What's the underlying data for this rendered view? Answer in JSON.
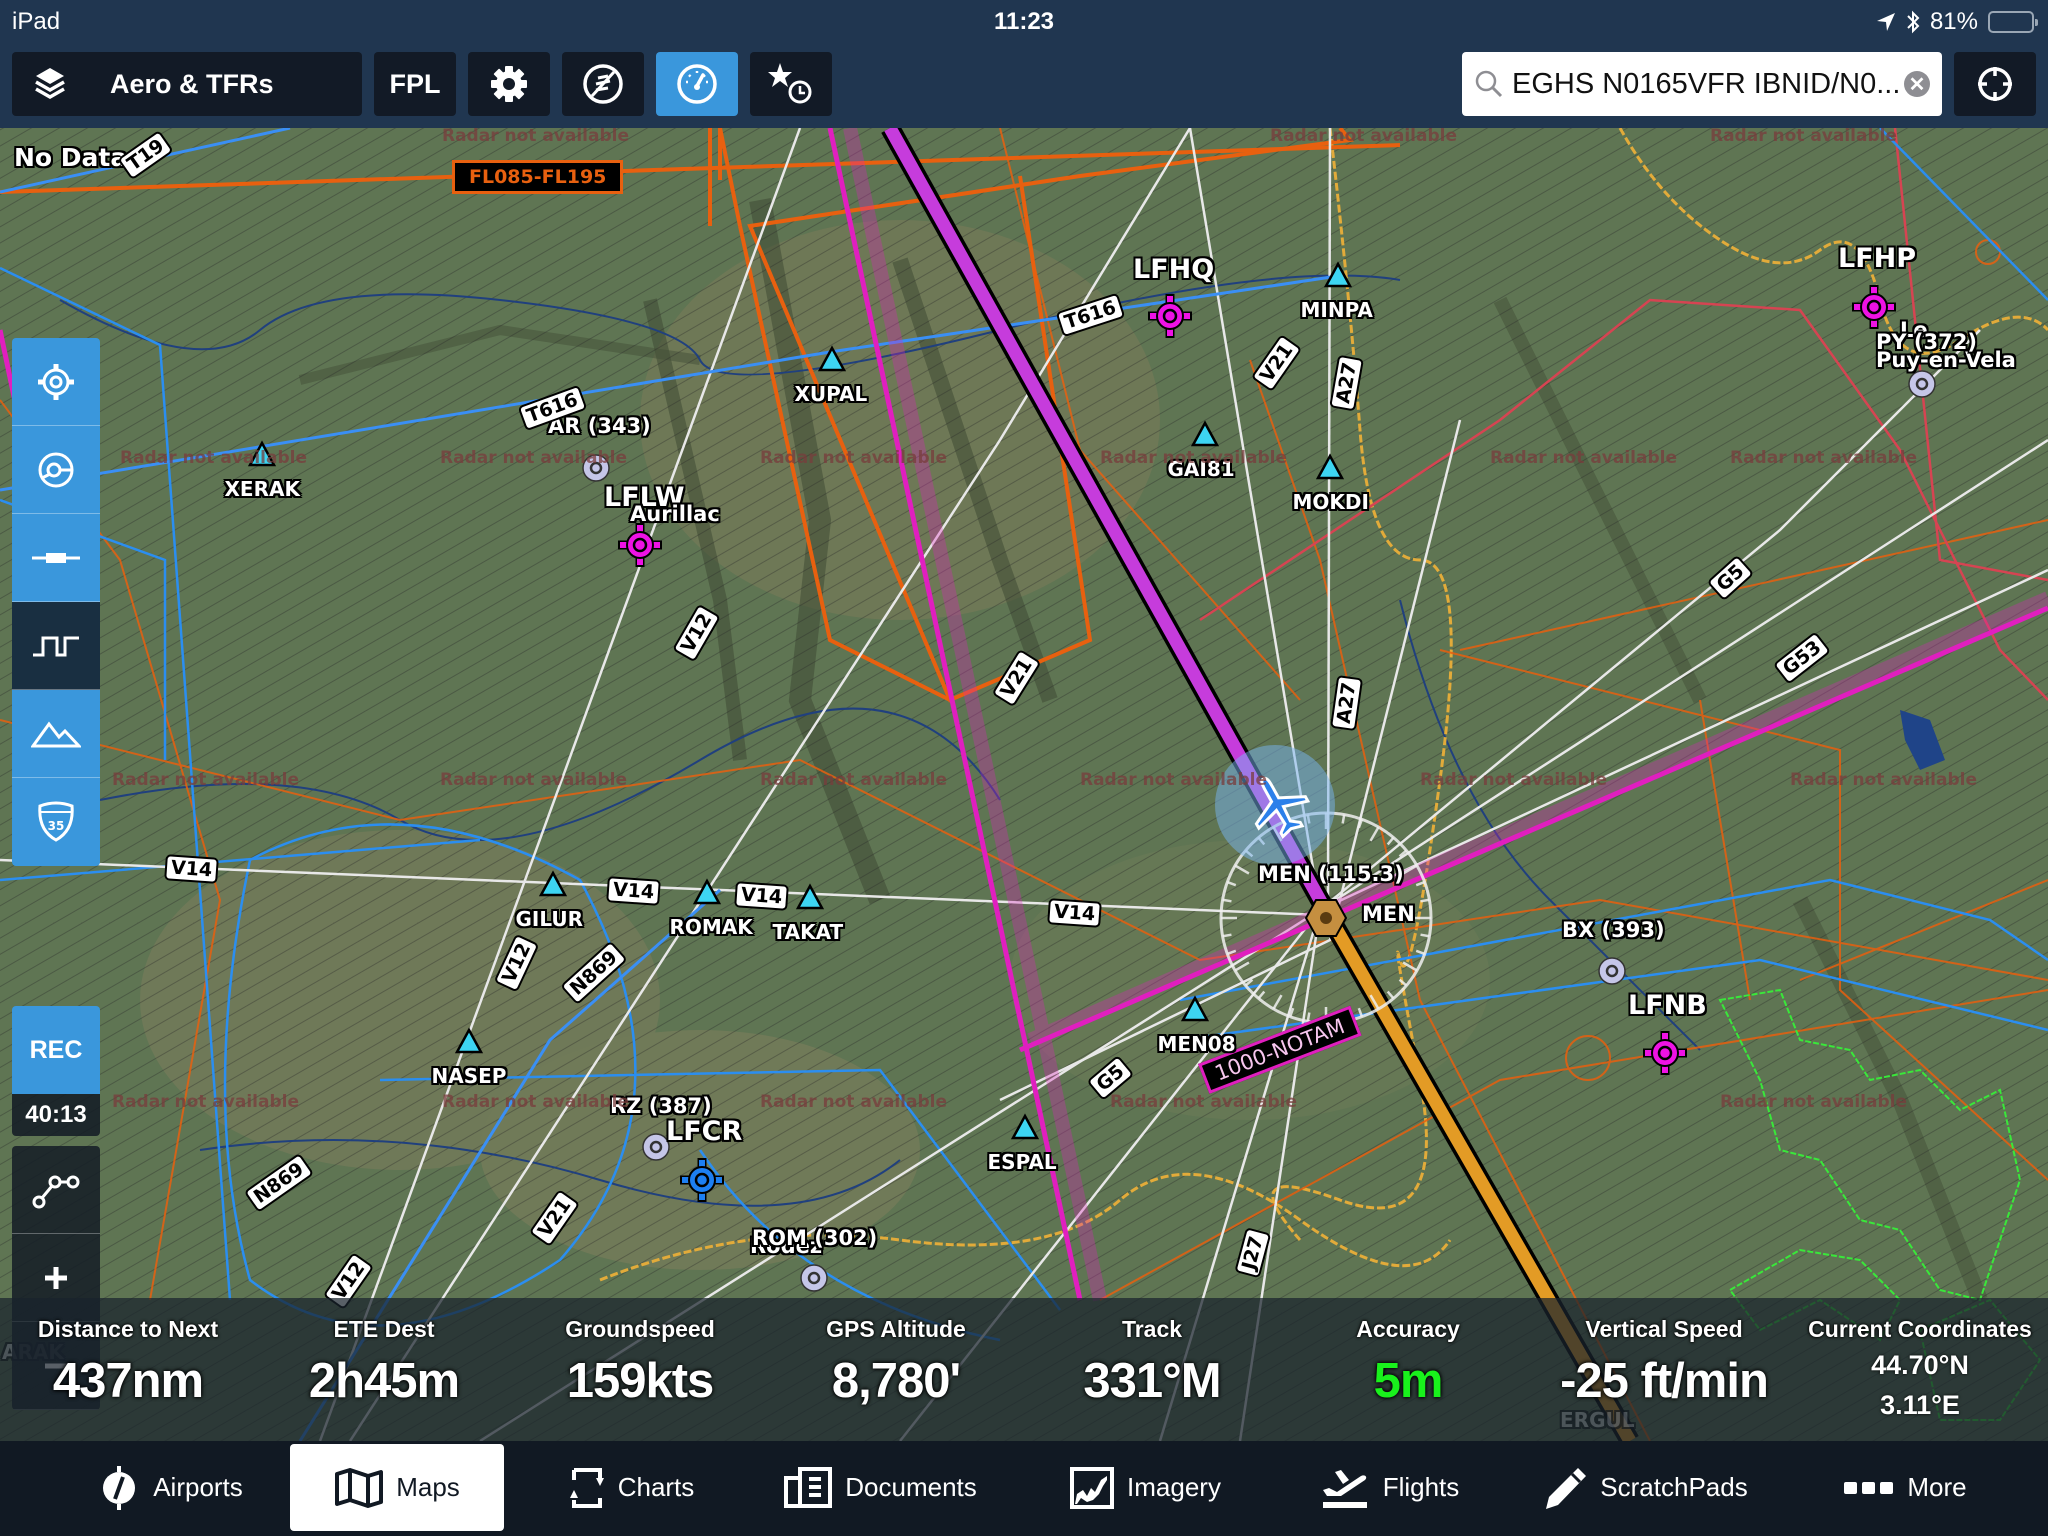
{
  "status_bar": {
    "device": "iPad",
    "time": "11:23",
    "battery_percent_label": "81%",
    "battery_level": 0.81
  },
  "toolbar": {
    "layers_label": "Aero & TFRs",
    "fpl_label": "FPL",
    "settings_icon": "gear-icon",
    "instruments_icon": "gauge-icon",
    "search": {
      "value": "EGHS N0165VFR IBNID/N0...",
      "placeholder": "Search"
    }
  },
  "map": {
    "no_data_label": "No Data",
    "altitude_box": "FL085-FL195",
    "notam_label": "1000-NOTAM",
    "radar_label": "Radar not available",
    "colors": {
      "route": "#c63cdc",
      "route_next": "#e39b25",
      "airway_low": "#f0f0f0",
      "airway_t": "#3a8ff5",
      "airspace": "#e8600f",
      "restricted": "#e01fbf",
      "waypoint": "#3dd5f2",
      "airport": "#ee12e4",
      "airport_towered": "#1d7ff2",
      "ndb": "#c5c6e8"
    },
    "waypoints": [
      {
        "name": "XERAK"
      },
      {
        "name": "XUPAL"
      },
      {
        "name": "MINPA"
      },
      {
        "name": "GAI81"
      },
      {
        "name": "MOKDI"
      },
      {
        "name": "GILUR"
      },
      {
        "name": "ROMAK"
      },
      {
        "name": "TAKAT"
      },
      {
        "name": "NASEP"
      },
      {
        "name": "MEN08"
      },
      {
        "name": "ESPAL"
      }
    ],
    "airports": [
      {
        "code": "LFHQ"
      },
      {
        "code": "LFLW",
        "city": "Aurillac"
      },
      {
        "code": "LFHP",
        "city": "Le Puy-en-Vela"
      },
      {
        "code": "LFNB"
      },
      {
        "code": "LFCR",
        "city": "Rodez"
      }
    ],
    "navaids": [
      {
        "label": "AR (343)"
      },
      {
        "label": "PY (372)"
      },
      {
        "label": "BX (393)"
      },
      {
        "label": "RZ (387)"
      },
      {
        "label": "ROM (302)"
      },
      {
        "label": "MEN (115.3)"
      },
      {
        "label": "MEN"
      }
    ],
    "airways": [
      "T19",
      "T616",
      "T616",
      "V21",
      "A27",
      "V12",
      "V21",
      "A27",
      "G5",
      "G53",
      "V14",
      "V14",
      "V14",
      "V14",
      "N869",
      "V12",
      "G5",
      "N869",
      "V21",
      "V12",
      "J27"
    ],
    "edge_labels": [
      "ARAK",
      "ERGUL"
    ]
  },
  "left_controls": {
    "top_group": [
      "center-target-icon",
      "track-up-icon",
      "runway-icon"
    ],
    "profile": "profile-view-icon",
    "terrain_group": [
      "terrain-icon",
      "highway-shield-icon"
    ],
    "shield_number": "35",
    "rec_label": "REC",
    "rec_timer": "40:13",
    "bottom_group": [
      "route-edit-icon",
      "zoom-in-icon",
      "zoom-out-icon"
    ]
  },
  "instruments": [
    {
      "label": "Distance to Next",
      "value": "437nm"
    },
    {
      "label": "ETE Dest",
      "value": "2h45m"
    },
    {
      "label": "Groundspeed",
      "value": "159kts"
    },
    {
      "label": "GPS Altitude",
      "value": "8,780'"
    },
    {
      "label": "Track",
      "value": "331°M"
    },
    {
      "label": "Accuracy",
      "value": "5m"
    },
    {
      "label": "Vertical Speed",
      "value": "-25 ft/min"
    },
    {
      "label": "Current Coordinates",
      "lat": "44.70°N",
      "lon": "3.11°E"
    }
  ],
  "tabs": [
    {
      "label": "Airports",
      "icon": "airport-icon"
    },
    {
      "label": "Maps",
      "icon": "map-icon",
      "active": true
    },
    {
      "label": "Charts",
      "icon": "charts-icon"
    },
    {
      "label": "Documents",
      "icon": "documents-icon"
    },
    {
      "label": "Imagery",
      "icon": "imagery-icon"
    },
    {
      "label": "Flights",
      "icon": "flights-icon"
    },
    {
      "label": "ScratchPads",
      "icon": "scratchpad-icon"
    },
    {
      "label": "More",
      "icon": "more-icon"
    }
  ]
}
